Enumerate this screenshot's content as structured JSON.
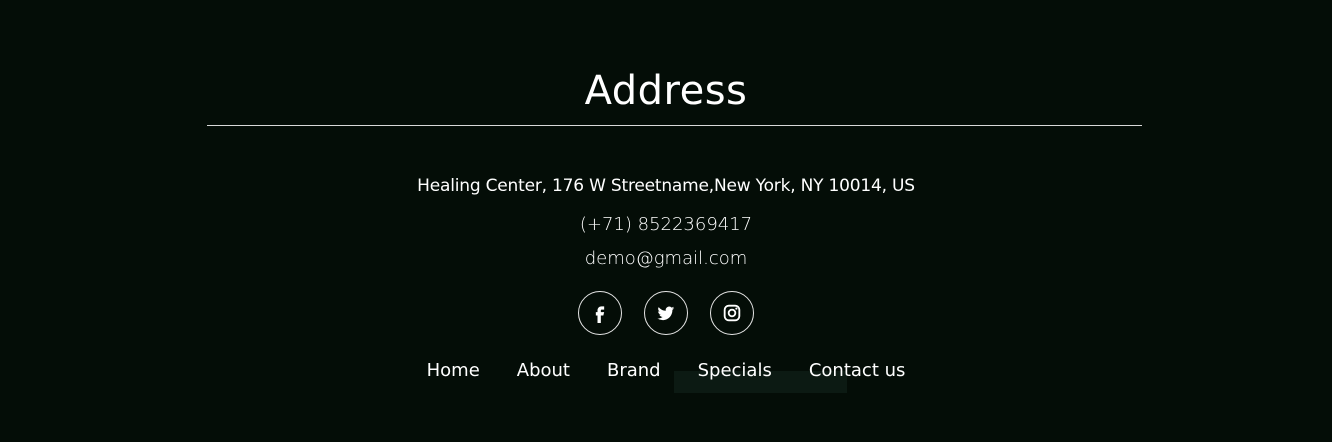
{
  "footer": {
    "title": "Address",
    "address": "Healing Center, 176 W Streetname,New York, NY 10014, US",
    "phone": "(+71) 8522369417",
    "email": "demo@gmail.com",
    "socials": [
      {
        "name": "Facebook",
        "icon": "facebook-icon"
      },
      {
        "name": "Twitter",
        "icon": "twitter-icon"
      },
      {
        "name": "Instagram",
        "icon": "instagram-icon"
      }
    ],
    "nav": [
      "Home",
      "About",
      "Brand",
      "Specials",
      "Contact us"
    ]
  },
  "colors": {
    "background": "#040d07",
    "text": "#ffffff",
    "rule": "#d8d8d8"
  }
}
